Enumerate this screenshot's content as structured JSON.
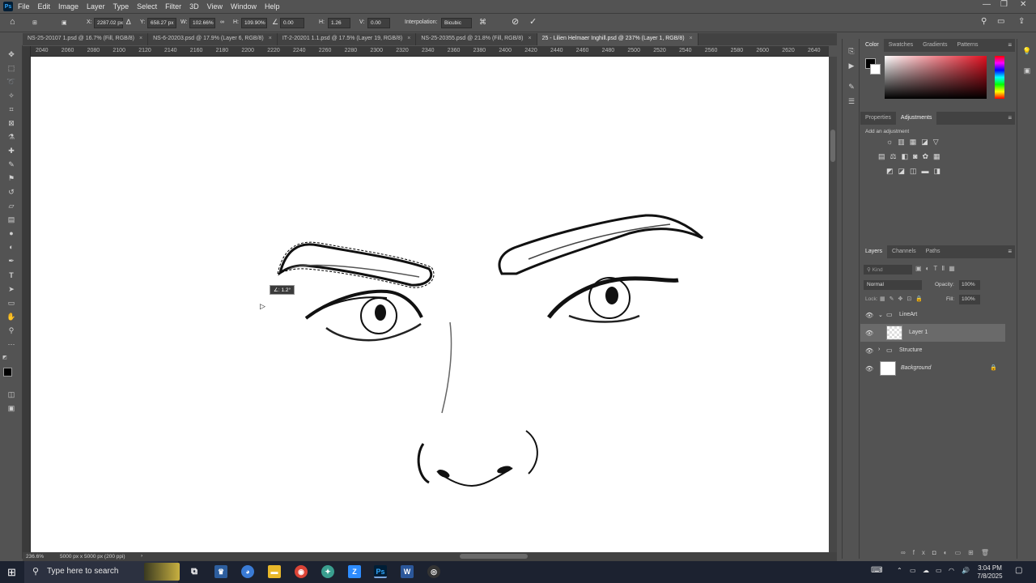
{
  "menubar": {
    "logo": "Ps",
    "items": [
      "File",
      "Edit",
      "Image",
      "Layer",
      "Type",
      "Select",
      "Filter",
      "3D",
      "View",
      "Window",
      "Help"
    ]
  },
  "options": {
    "x_label": "X:",
    "x_value": "2287.02 px",
    "y_label": "Y:",
    "y_value": "658.27 px",
    "w_label": "W:",
    "w_value": "102.66%",
    "h_label": "H:",
    "h_value": "109.90%",
    "angle_value": "0.00",
    "hskew_label": "H:",
    "hskew_value": "1.26",
    "vskew_label": "V:",
    "vskew_value": "0.00",
    "interp_label": "Interpolation:",
    "interp_value": "Bicubic"
  },
  "tabs": [
    {
      "label": "NS-25-20107 1.psd @ 16.7% (Fill, RGB/8)"
    },
    {
      "label": "NS-6-20203.psd @ 17.9% (Layer 6, RGB/8)"
    },
    {
      "label": "IT-2-20201 1.1.psd @ 17.5% (Layer 19, RGB/8)"
    },
    {
      "label": "NS-25-20355.psd @ 21.8% (Fill, RGB/8)"
    },
    {
      "label": "25 - Lilien Helmaer Inghill.psd @ 237% (Layer 1, RGB/8)"
    }
  ],
  "ruler_ticks": [
    "2040",
    "2060",
    "2080",
    "2100",
    "2120",
    "2140",
    "2160",
    "2180",
    "2200",
    "2220",
    "2240",
    "2260",
    "2280",
    "2300",
    "2320",
    "2340",
    "2360",
    "2380",
    "2400",
    "2420",
    "2440",
    "2460",
    "2480",
    "2500",
    "2520",
    "2540",
    "2560",
    "2580",
    "2600",
    "2620",
    "2640"
  ],
  "canvas": {
    "rotation_tooltip": "∠: 1.2°"
  },
  "status": {
    "zoom": "236.6%",
    "doc_size": "5000 px x 5000 px (200 ppi)"
  },
  "color_panel": {
    "tabs": [
      "Color",
      "Swatches",
      "Gradients",
      "Patterns"
    ]
  },
  "adjust_panel": {
    "tabs": [
      "Properties",
      "Adjustments"
    ],
    "hint": "Add an adjustment"
  },
  "layers_panel": {
    "tabs": [
      "Layers",
      "Channels",
      "Paths"
    ],
    "kind_placeholder": "Kind",
    "blend_mode": "Normal",
    "opacity_label": "Opacity:",
    "opacity_value": "100%",
    "lock_label": "Lock:",
    "fill_label": "Fill:",
    "fill_value": "100%",
    "layers": [
      {
        "name": "LineArt",
        "type": "group"
      },
      {
        "name": "Layer 1",
        "type": "layer"
      },
      {
        "name": "Structure",
        "type": "group"
      },
      {
        "name": "Background",
        "type": "background"
      }
    ]
  },
  "taskbar": {
    "search_placeholder": "Type here to search",
    "time": "3:04 PM",
    "date": "7/8/2025"
  },
  "colors": {
    "accent": "#31a8ff",
    "panel_bg": "#535353",
    "canvas_bg": "#ffffff"
  }
}
